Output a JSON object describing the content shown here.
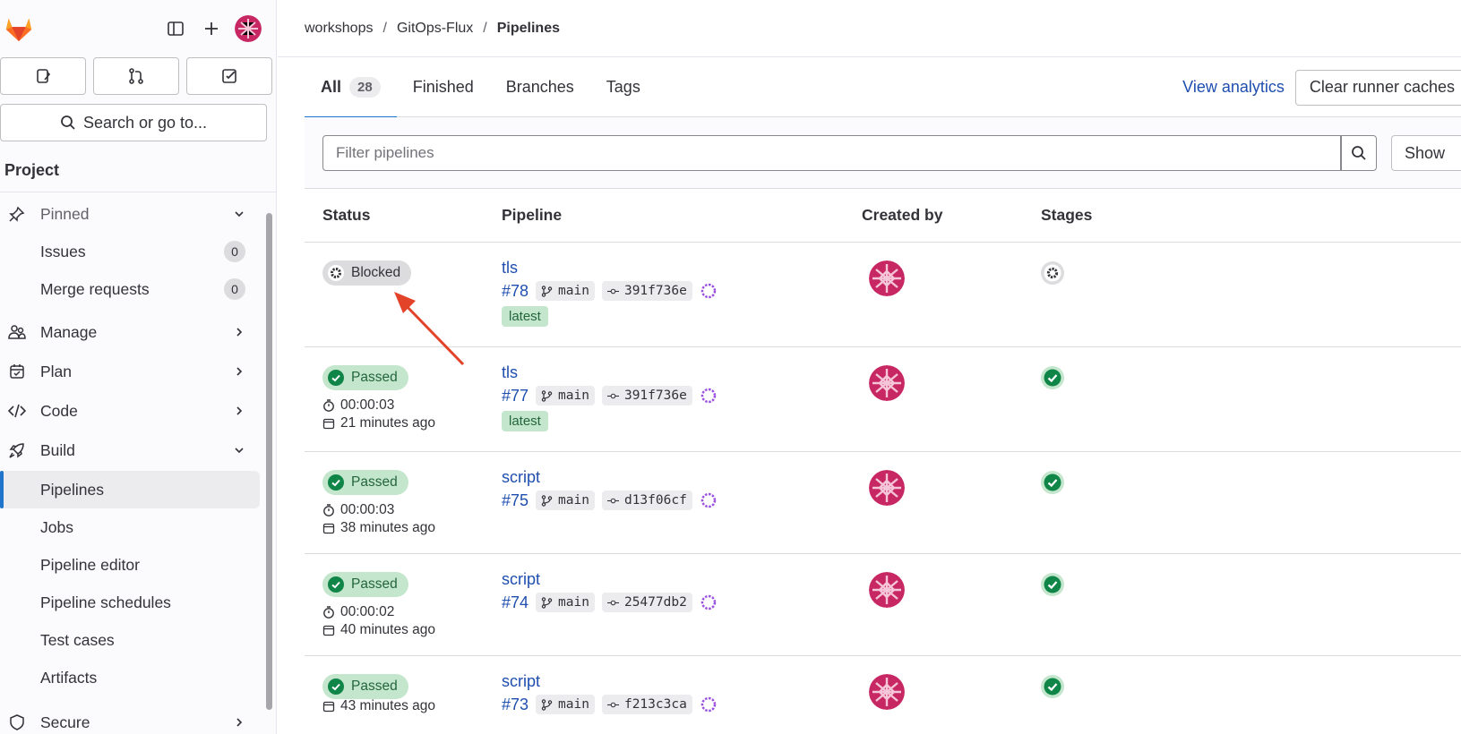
{
  "sidebar": {
    "search_label": "Search or go to...",
    "section_title": "Project",
    "items": [
      {
        "label": "Pinned",
        "icon": "pin-icon",
        "expanded": true
      },
      {
        "label": "Issues",
        "count": "0"
      },
      {
        "label": "Merge requests",
        "count": "0"
      },
      {
        "label": "Manage",
        "icon": "users-icon"
      },
      {
        "label": "Plan",
        "icon": "calendar-icon"
      },
      {
        "label": "Code",
        "icon": "code-icon"
      },
      {
        "label": "Build",
        "icon": "rocket-icon",
        "expanded": true
      },
      {
        "label": "Pipelines",
        "active": true
      },
      {
        "label": "Jobs"
      },
      {
        "label": "Pipeline editor"
      },
      {
        "label": "Pipeline schedules"
      },
      {
        "label": "Test cases"
      },
      {
        "label": "Artifacts"
      },
      {
        "label": "Secure",
        "icon": "shield-icon"
      }
    ]
  },
  "breadcrumb": [
    "workshops",
    "GitOps-Flux",
    "Pipelines"
  ],
  "tabs": [
    {
      "label": "All",
      "count": "28",
      "active": true
    },
    {
      "label": "Finished"
    },
    {
      "label": "Branches"
    },
    {
      "label": "Tags"
    }
  ],
  "actions": {
    "view_analytics": "View analytics",
    "clear_caches": "Clear runner caches"
  },
  "filter": {
    "placeholder": "Filter pipelines",
    "show_label": "Show"
  },
  "columns": {
    "status": "Status",
    "pipeline": "Pipeline",
    "created_by": "Created by",
    "stages": "Stages"
  },
  "colors": {
    "accent": "#1f75cb",
    "link": "#1f4eaf",
    "passed_bg": "#c3e6cd",
    "passed_fg": "#24663b",
    "blocked_bg": "#dcdcde",
    "annotation_arrow": "#e24329"
  },
  "pipelines": [
    {
      "status": "Blocked",
      "duration": "",
      "time_ago": "",
      "title": "tls",
      "id": "#78",
      "branch": "main",
      "commit": "391f736e",
      "latest": "latest",
      "stage_status": "blocked"
    },
    {
      "status": "Passed",
      "duration": "00:00:03",
      "time_ago": "21 minutes ago",
      "title": "tls",
      "id": "#77",
      "branch": "main",
      "commit": "391f736e",
      "latest": "latest",
      "stage_status": "passed"
    },
    {
      "status": "Passed",
      "duration": "00:00:03",
      "time_ago": "38 minutes ago",
      "title": "script",
      "id": "#75",
      "branch": "main",
      "commit": "d13f06cf",
      "latest": "",
      "stage_status": "passed"
    },
    {
      "status": "Passed",
      "duration": "00:00:02",
      "time_ago": "40 minutes ago",
      "title": "script",
      "id": "#74",
      "branch": "main",
      "commit": "25477db2",
      "latest": "",
      "stage_status": "passed"
    },
    {
      "status": "Passed",
      "duration": "",
      "time_ago": "43 minutes ago",
      "title": "script",
      "id": "#73",
      "branch": "main",
      "commit": "f213c3ca",
      "latest": "",
      "stage_status": "passed"
    }
  ]
}
